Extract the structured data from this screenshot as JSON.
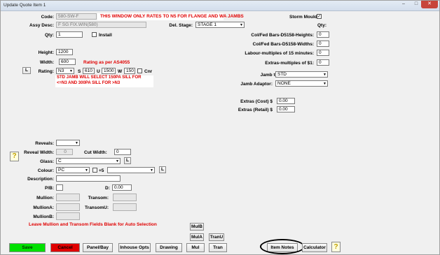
{
  "window": {
    "title": "Update Quote Item 1"
  },
  "banner": "THIS WINDOW ONLY RATES TO N5 FOR FLANGE AND WA JAMBS",
  "code": {
    "label": "Code:",
    "value": "580-SW-F"
  },
  "assy_desc": {
    "label": "Assy Desc:",
    "value": "F SG FIX.WIN(580)"
  },
  "del_stage": {
    "label": "Del. Stage:",
    "value": "STAGE 1"
  },
  "qty": {
    "label": "Qty:",
    "value": "1"
  },
  "install": {
    "label": "Install",
    "checked": false
  },
  "height": {
    "label": "Height:",
    "value": "1200"
  },
  "width": {
    "label": "Width:",
    "value": "600"
  },
  "rating_note": "Rating as per AS4055",
  "rating": {
    "button": "L",
    "label": "Rating:",
    "value": "N3",
    "s_label": "S",
    "s_value": "610",
    "u_label": "U",
    "u_value": "1500",
    "w_label": "W",
    "w_value": "150",
    "cnr_label": "Cnr"
  },
  "jamb_note": "STD JAMB WILL SELECT 150PA SILL FOR <=N3 AND 300PA SILL FOR >N3",
  "storm_mould": {
    "label": "Storm Mould:",
    "checked": true
  },
  "qty_header": "Qty:",
  "right_fields": [
    {
      "label": "Col/Fed Bars-D5158-Heights:",
      "value": "0"
    },
    {
      "label": "Col/Fed Bars-D5158-Widths:",
      "value": "0"
    },
    {
      "label": "Labour-multiples of 15 minutes:",
      "value": "0"
    },
    {
      "label": "Extras-multiples of $1:",
      "value": "0"
    }
  ],
  "jamb_type": {
    "label": "Jamb type:",
    "value": "STD"
  },
  "jamb_adaptor": {
    "label": "Jamb Adaptor:",
    "value": "NONE"
  },
  "extras_cost": {
    "label": "Extras (Cost) $",
    "value": "0.00"
  },
  "extras_retail": {
    "label": "Extras (Retail) $",
    "value": "0.00"
  },
  "reveals": {
    "label": "Reveals:",
    "value": ""
  },
  "reveal_width": {
    "label": "Reveal Width:",
    "value": "0"
  },
  "cut_width": {
    "label": "Cut Width:",
    "value": "0"
  },
  "glass": {
    "label": "Glass:",
    "value": "C",
    "button": "L"
  },
  "colour": {
    "label": "Colour:",
    "value": "PC",
    "plus5": "+5",
    "button": "L",
    "second_value": ""
  },
  "description": {
    "label": "Description:",
    "value": ""
  },
  "pb": {
    "label": "P/B:",
    "value": ""
  },
  "d": {
    "label": "D:",
    "value": "0.00"
  },
  "mullion": {
    "label": "Mullion:",
    "value": ""
  },
  "mullion_a": {
    "label": "MullionA:",
    "value": ""
  },
  "mullion_b": {
    "label": "MullionB:",
    "value": ""
  },
  "transom": {
    "label": "Transom:",
    "value": ""
  },
  "transom_u": {
    "label": "TransomU:",
    "value": ""
  },
  "mullion_note": "Leave Mullion and Transom Fields Blank for Auto Selection",
  "buttons": {
    "mulb": "MulB",
    "mula": "MulA",
    "tranu": "TranU",
    "save": "Save",
    "cancel": "Cancel",
    "panel_bay": "Panel/Bay",
    "inhouse_opts": "Inhouse Opts",
    "drawing": "Drawing",
    "mul": "Mul",
    "tran": "Tran",
    "item_notes": "Item Notes",
    "calculator": "Calculator",
    "help": "?"
  },
  "colors": {
    "save": "#00e000",
    "cancel": "#e00000",
    "note_red": "#e00000"
  }
}
